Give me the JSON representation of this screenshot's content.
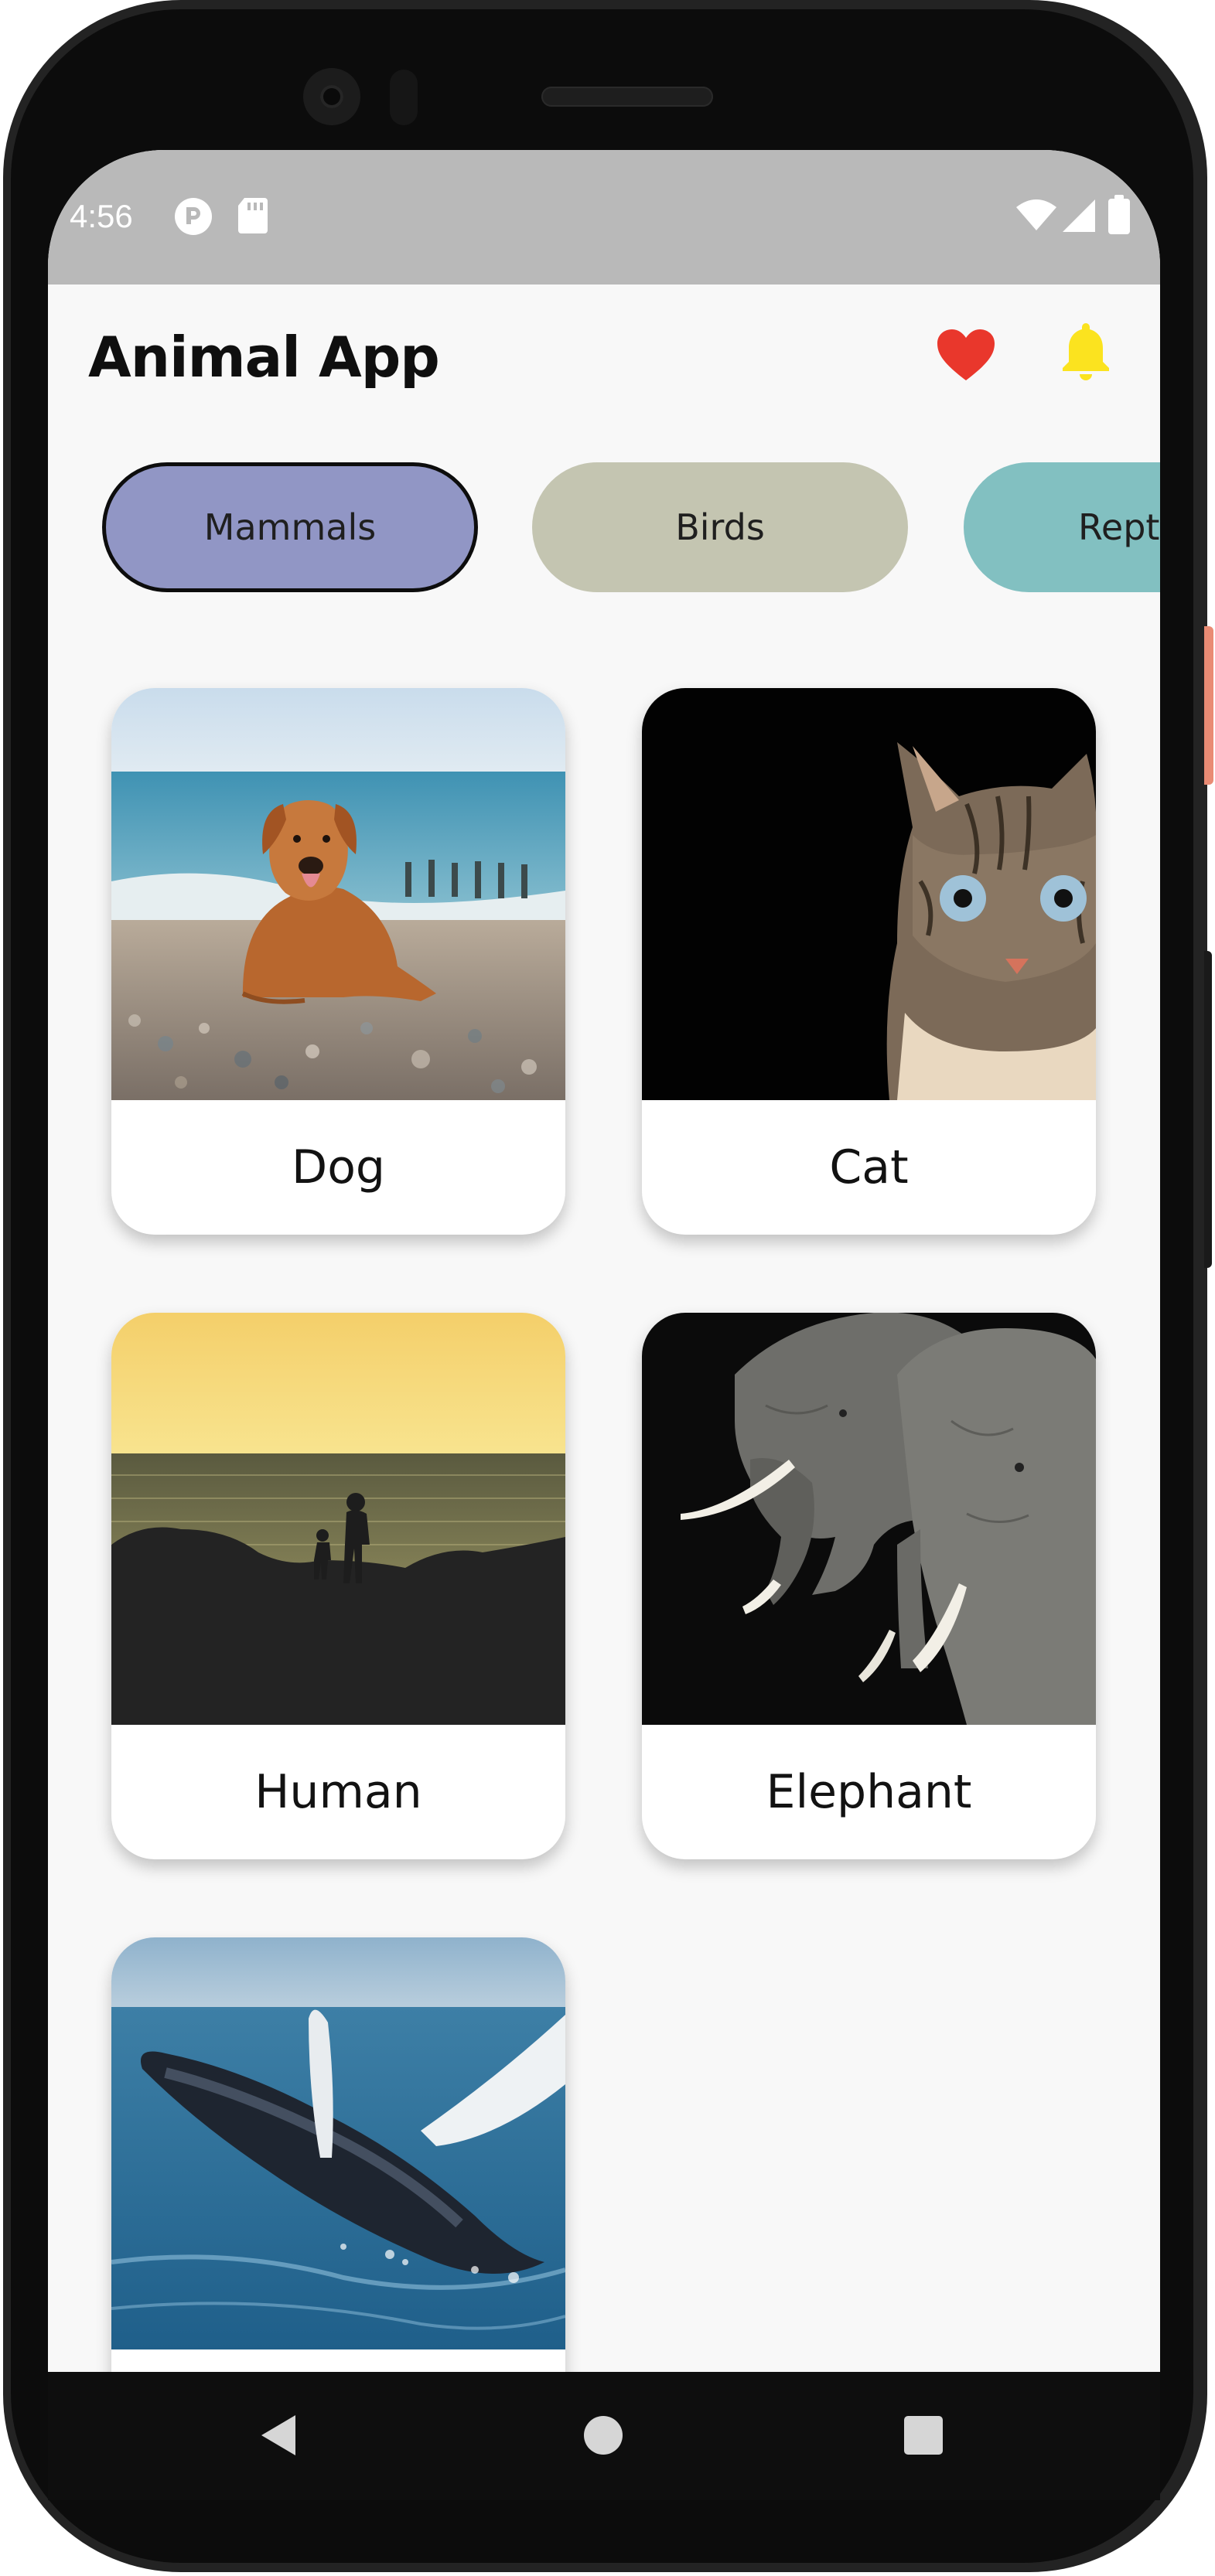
{
  "status_bar": {
    "time": "4:56"
  },
  "app_bar": {
    "title": "Animal App"
  },
  "categories": [
    {
      "label": "Mammals",
      "color": "#9196c5",
      "selected": true
    },
    {
      "label": "Birds",
      "color": "#c4c5b1",
      "selected": false
    },
    {
      "label": "Rept",
      "color": "#82c0c1",
      "selected": false
    }
  ],
  "animals": [
    {
      "name": "Dog"
    },
    {
      "name": "Cat"
    },
    {
      "name": "Human"
    },
    {
      "name": "Elephant"
    },
    {
      "name": ""
    }
  ],
  "colors": {
    "favorite": "#e9372c",
    "notification": "#fbe31f",
    "status_bar": "#b9b9b9",
    "background": "#f8f8f8"
  },
  "icons": {
    "favorite": "heart-icon",
    "notification": "bell-icon",
    "back": "back-triangle-icon",
    "home": "home-circle-icon",
    "recents": "recents-square-icon"
  }
}
